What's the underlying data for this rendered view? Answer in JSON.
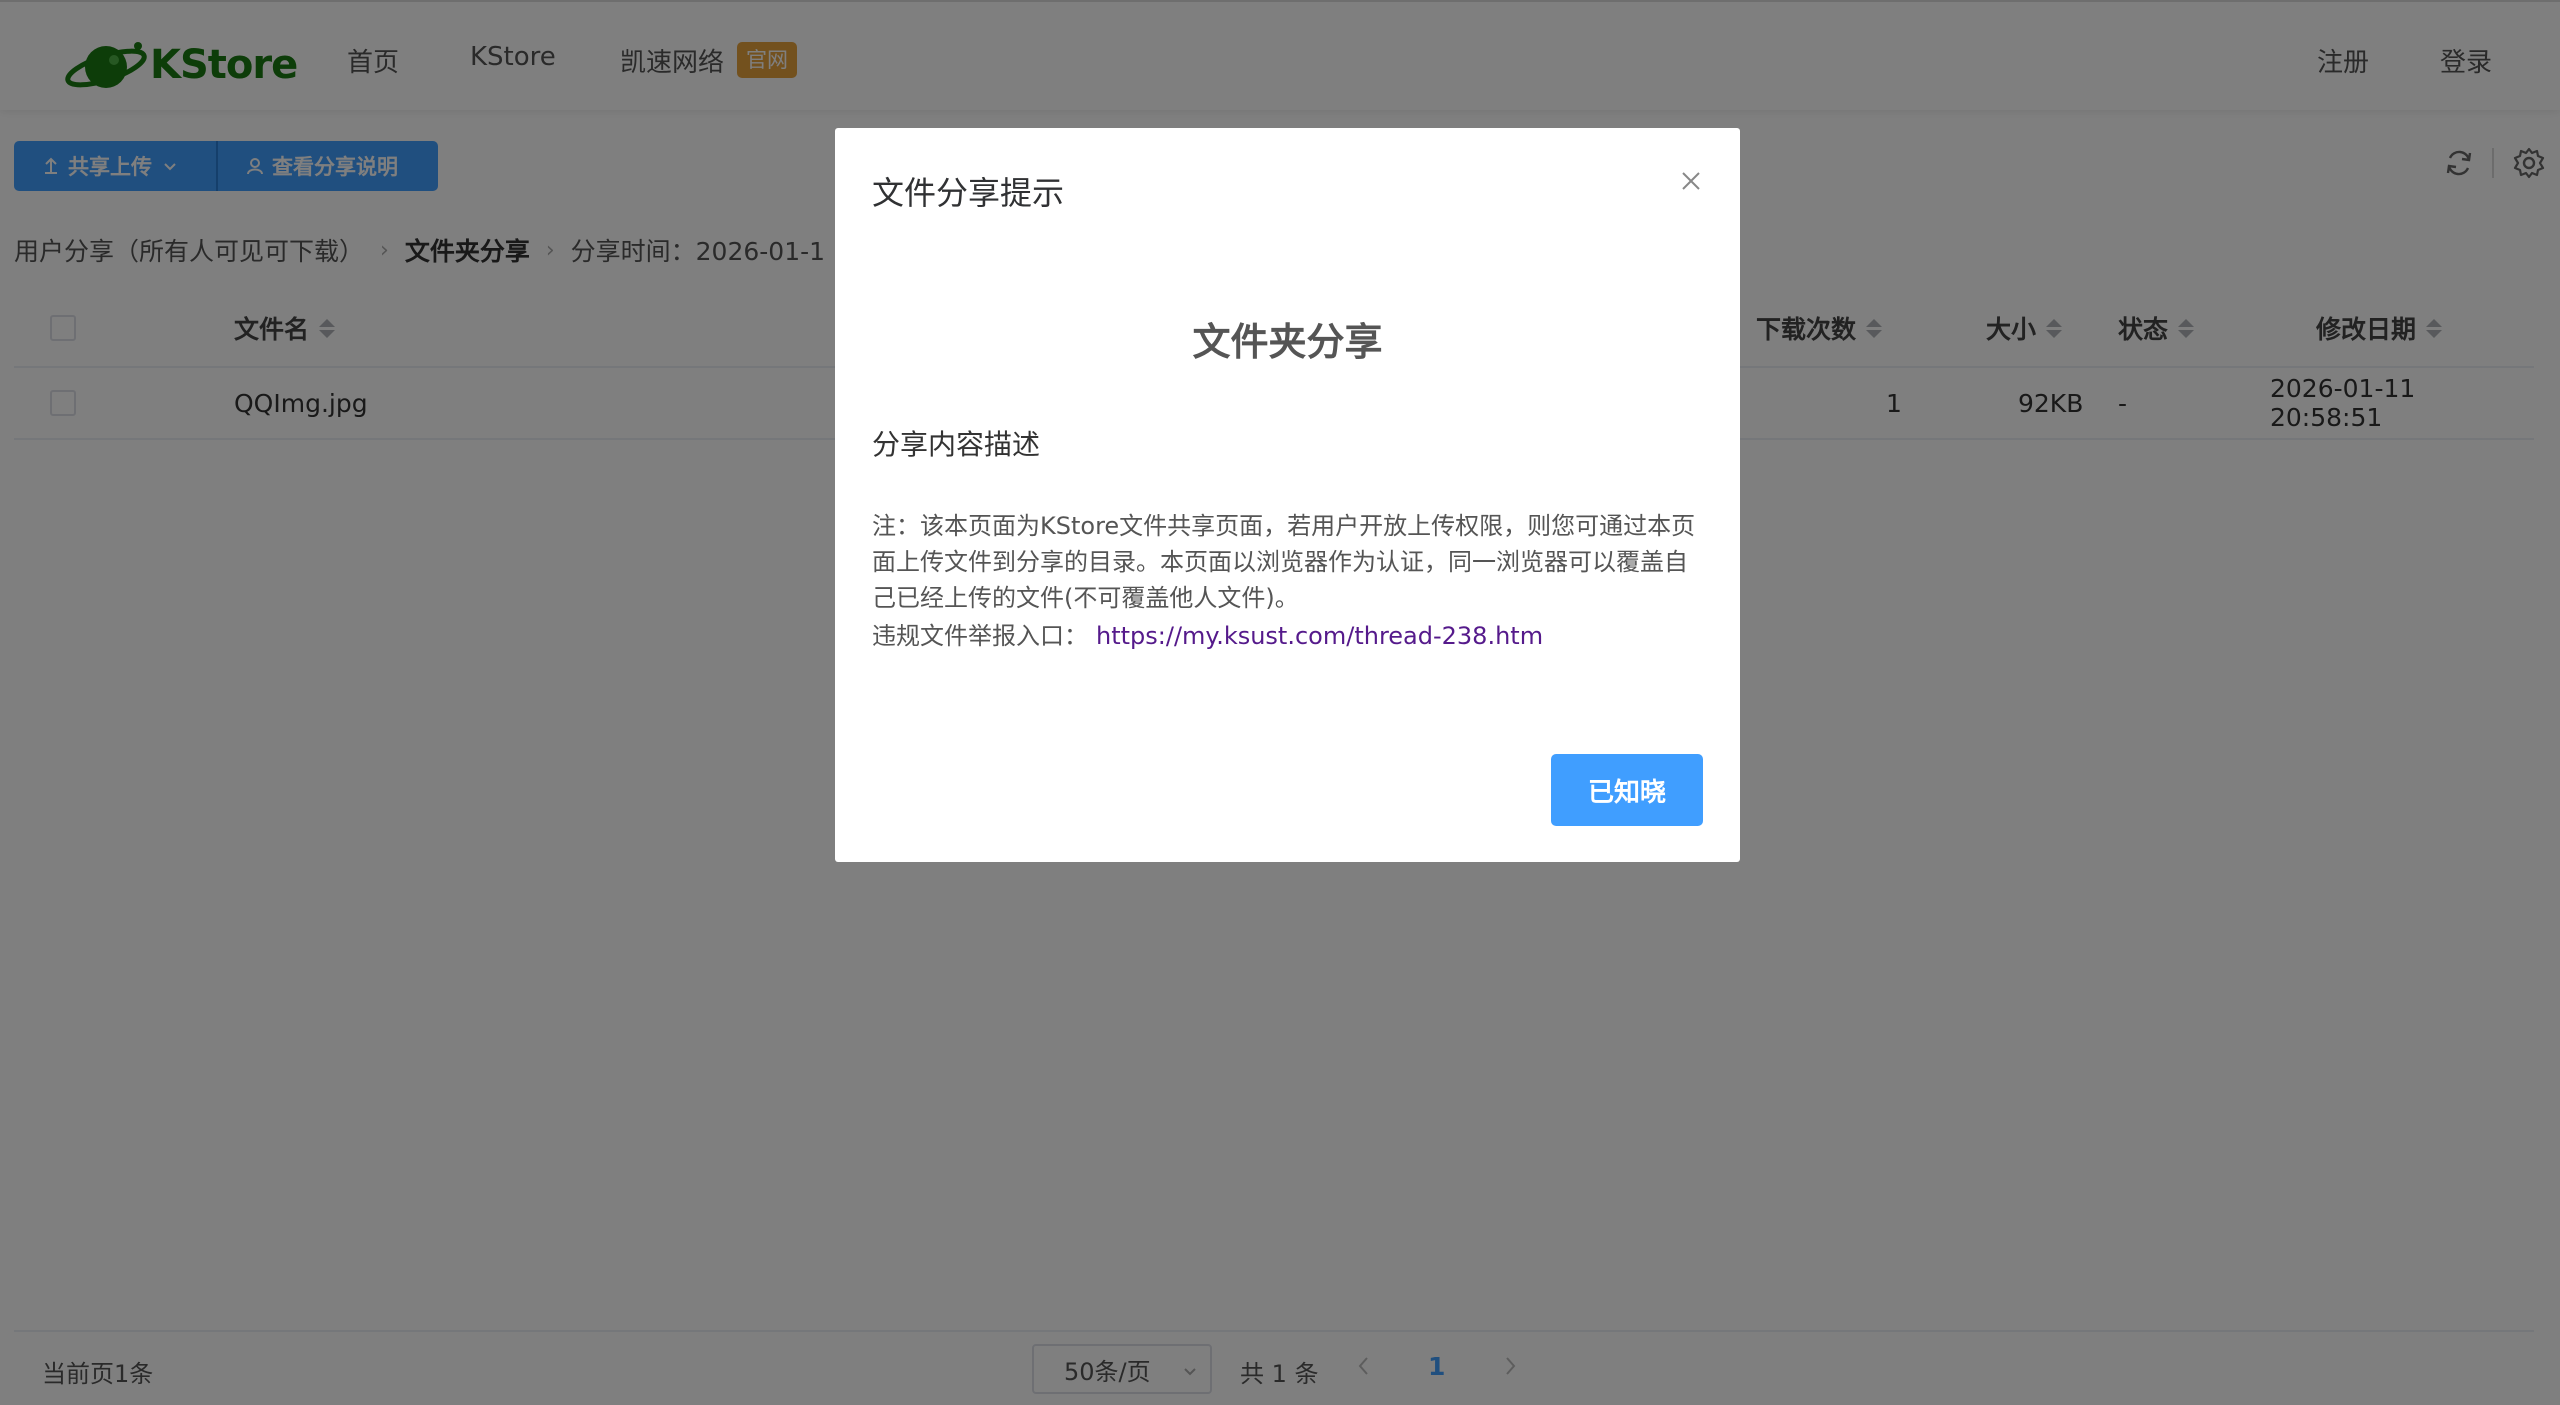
{
  "brand": {
    "name": "KStore",
    "green": "#1a7a12"
  },
  "nav": {
    "items": [
      "首页",
      "KStore",
      "凯速网络"
    ],
    "badge": "官网"
  },
  "auth": {
    "register": "注册",
    "login": "登录"
  },
  "toolbar": {
    "upload_label": "共享上传",
    "help_label": "查看分享说明",
    "refresh_icon": "refresh-icon",
    "settings_icon": "gear-icon"
  },
  "breadcrumb": {
    "root": "用户分享（所有人可见可下载）",
    "folder": "文件夹分享",
    "time": "分享时间：2026-01-1"
  },
  "table": {
    "headers": {
      "name": "文件名",
      "downloads": "下载次数",
      "size": "大小",
      "status": "状态",
      "modified": "修改日期"
    },
    "rows": [
      {
        "name": "QQImg.jpg",
        "downloads": "1",
        "size": "92KB",
        "status": "-",
        "modified": "2026-01-11 20:58:51"
      }
    ]
  },
  "footer": {
    "count": "当前页1条",
    "page_size": "50条/页",
    "total": "共 1 条",
    "current_page": "1"
  },
  "modal": {
    "title": "文件分享提示",
    "heading": "文件夹分享",
    "subheading": "分享内容描述",
    "note": "注：该本页面为KStore文件共享页面，若用户开放上传权限，则您可通过本页面上传文件到分享的目录。本页面以浏览器作为认证，同一浏览器可以覆盖自己已经上传的文件(不可覆盖他人文件)。",
    "report_label": "违规文件举报入口：",
    "report_link": "https://my.ksust.com/thread-238.htm",
    "confirm_label": "已知晓"
  },
  "colors": {
    "primary": "#409eff",
    "badge": "#e6a23c",
    "link": "#551a8b"
  }
}
